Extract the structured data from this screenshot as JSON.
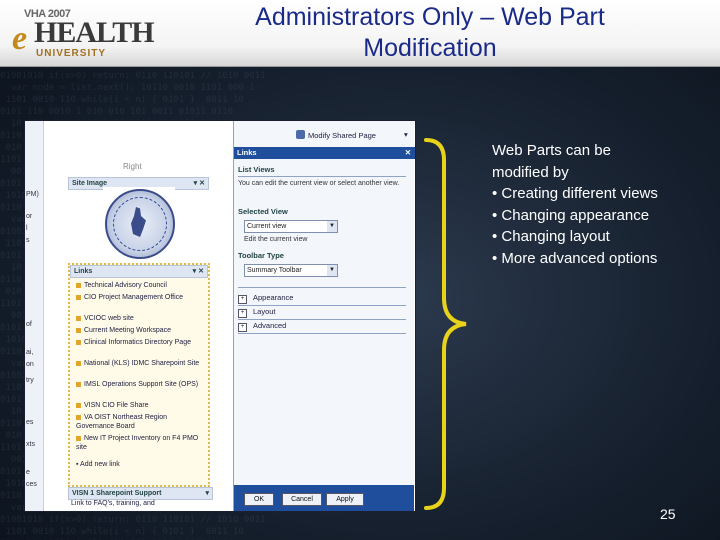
{
  "header": {
    "logo_year": "VHA 2007",
    "logo_e": "e",
    "logo_health": "HEALTH",
    "logo_univ": "UNIVERSITY",
    "title_line1": "Administrators Only – Web Part",
    "title_line2": "Modification"
  },
  "screenshot": {
    "left_strip": [
      "PM)",
      "or",
      "l",
      "s",
      "of",
      "ai,",
      "on",
      "try",
      "es",
      "xts",
      "e",
      "ces"
    ],
    "right_label": "Right",
    "site_image_header": "Site Image",
    "links_header": "Links",
    "links": [
      "Technical Advisory Council",
      "CIO Project Management Office",
      "VCIOC web site",
      "Current Meeting Workspace",
      "Clinical Informatics Directory Page",
      "National (KLS) IDMC Sharepoint Site",
      "IMSL Operations Support Site (OPS)",
      "VISN CIO File Share",
      "VA OIST Northeast Region Governance Board",
      "New IT Project Inventory on F4 PMO site"
    ],
    "add_link": "Add new link",
    "visn_header": "VISN 1 Sharepoint Support",
    "visn_sub": "Link to FAQ's, training, and",
    "toolpane": {
      "modify_label": "Modify Shared Page",
      "header": "Links",
      "list_views": "List Views",
      "list_views_desc": "You can edit the current view or select another view.",
      "selected_view_label": "Selected View",
      "selected_view_value": "Current view",
      "edit_current_view": "Edit the current view",
      "toolbar_type_label": "Toolbar Type",
      "toolbar_type_value": "Summary Toolbar",
      "sections": [
        "Appearance",
        "Layout",
        "Advanced"
      ],
      "ok": "OK",
      "cancel": "Cancel",
      "apply": "Apply"
    }
  },
  "bullets": {
    "line1": "Web Parts can be",
    "line2": "modified by",
    "line3": "• Creating different views",
    "line4": "• Changing appearance",
    "line5": "• Changing layout",
    "line6": "• More advanced options"
  },
  "page_number": "25"
}
